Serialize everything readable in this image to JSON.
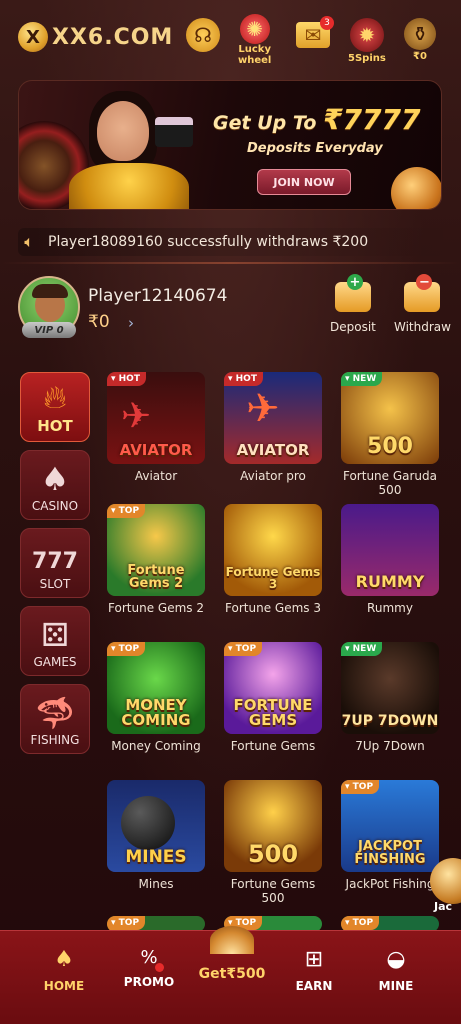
{
  "header": {
    "logo_mark": "X",
    "logo_text": "XX6.COM",
    "icons": [
      {
        "name": "support",
        "label": ""
      },
      {
        "name": "lucky-wheel",
        "label": "Lucky\nwheel"
      },
      {
        "name": "mail",
        "label": "",
        "badge": "3"
      },
      {
        "name": "spins",
        "label": "5Spins"
      },
      {
        "name": "wallet",
        "label": "₹0"
      }
    ]
  },
  "banner": {
    "title_prefix": "Get Up To",
    "title_amount": "₹7777",
    "subtitle": "Deposits Everyday",
    "button": "JOIN NOW"
  },
  "marquee": {
    "text": "Player18089160 successfully withdraws ₹200"
  },
  "user": {
    "name": "Player12140674",
    "balance": "₹0",
    "vip": "VIP 0",
    "deposit": "Deposit",
    "withdraw": "Withdraw"
  },
  "categories": [
    {
      "label": "HOT",
      "active": true
    },
    {
      "label": "CASINO",
      "active": false
    },
    {
      "label": "SLOT",
      "active": false
    },
    {
      "label": "GAMES",
      "active": false
    },
    {
      "label": "FISHING",
      "active": false
    }
  ],
  "games": [
    {
      "name": "Aviator",
      "thumb": "AVIATOR",
      "tag": "HOT"
    },
    {
      "name": "Aviator pro",
      "thumb": "AVIATOR",
      "tag": "HOT"
    },
    {
      "name": "Fortune Garuda 500",
      "thumb": "500",
      "tag": "NEW"
    },
    {
      "name": "Fortune Gems 2",
      "thumb": "Fortune Gems 2",
      "tag": "TOP"
    },
    {
      "name": "Fortune Gems 3",
      "thumb": "Fortune Gems 3",
      "tag": ""
    },
    {
      "name": "Rummy",
      "thumb": "RUMMY",
      "tag": ""
    },
    {
      "name": "Money Coming",
      "thumb": "MONEY COMING",
      "tag": "TOP"
    },
    {
      "name": "Fortune Gems",
      "thumb": "FORTUNE GEMS",
      "tag": "TOP"
    },
    {
      "name": "7Up 7Down",
      "thumb": "7UP 7DOWN",
      "tag": "NEW"
    },
    {
      "name": "Mines",
      "thumb": "MINES",
      "tag": ""
    },
    {
      "name": "Fortune Gems 500",
      "thumb": "500",
      "tag": ""
    },
    {
      "name": "JackPot Fishing",
      "thumb": "JACKPOT FINSHING",
      "tag": "TOP"
    }
  ],
  "next_row_tags": [
    "TOP",
    "TOP",
    "TOP"
  ],
  "floating_label": "Jac",
  "nav": {
    "home": "HOME",
    "promo": "PROMO",
    "get": "Get₹500",
    "earn": "EARN",
    "mine": "MINE"
  },
  "colors": {
    "accent_gold": "#ffd36a",
    "nav_red": "#8a1418",
    "hot_tag": "#c52a2a",
    "top_tag": "#e2862a",
    "new_tag": "#2aa84c"
  }
}
